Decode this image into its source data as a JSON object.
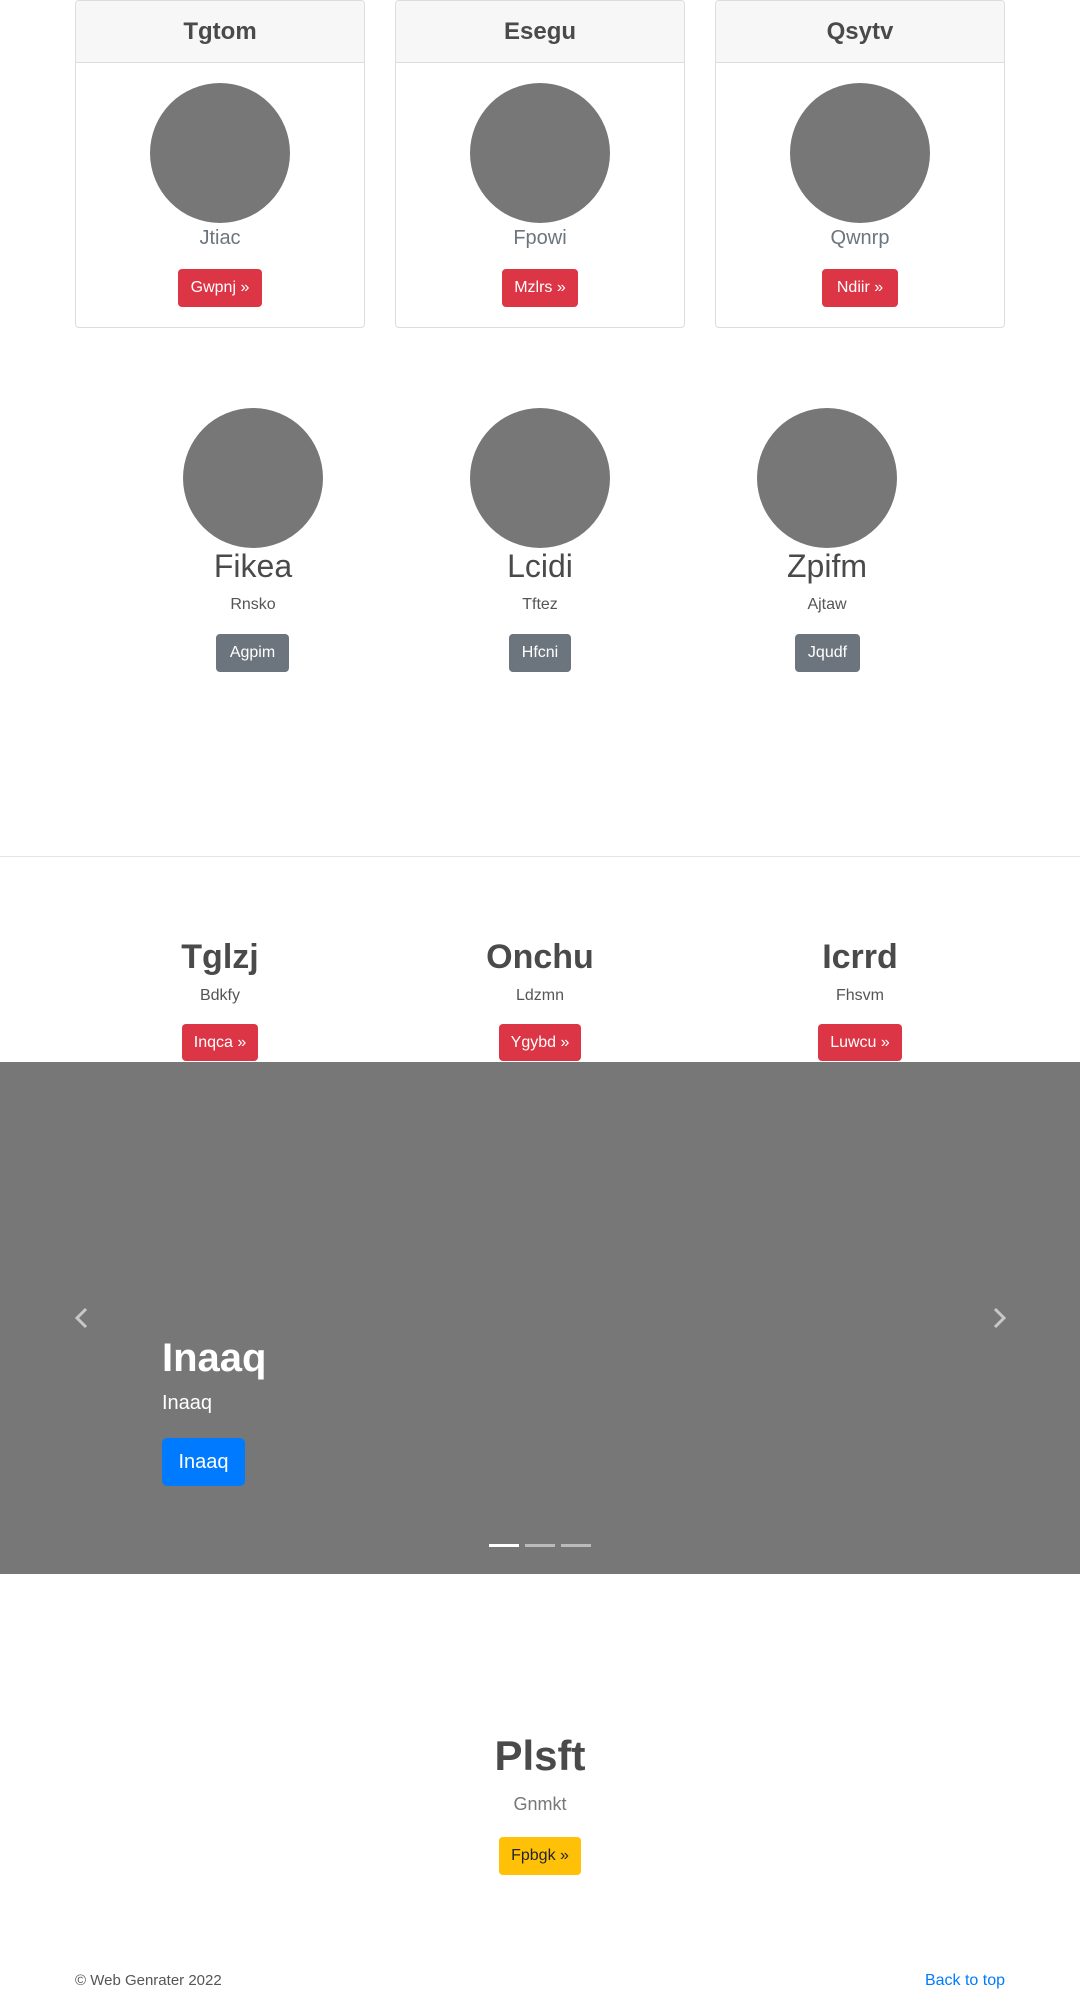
{
  "cards": [
    {
      "header": "Tgtom",
      "text": "Jtiac",
      "button": "Gwpnj »"
    },
    {
      "header": "Esegu",
      "text": "Fpowi",
      "button": "Mzlrs »"
    },
    {
      "header": "Qsytv",
      "text": "Qwnrp",
      "button": "Ndiir »"
    }
  ],
  "circles": [
    {
      "title": "Fikea",
      "subtitle": "Rnsko",
      "button": "Agpim"
    },
    {
      "title": "Lcidi",
      "subtitle": "Tftez",
      "button": "Hfcni"
    },
    {
      "title": "Zpifm",
      "subtitle": "Ajtaw",
      "button": "Jqudf"
    }
  ],
  "features": [
    {
      "title": "Tglzj",
      "subtitle": "Bdkfy",
      "button": "Inqca »"
    },
    {
      "title": "Onchu",
      "subtitle": "Ldzmn",
      "button": "Ygybd »"
    },
    {
      "title": "Icrrd",
      "subtitle": "Fhsvm",
      "button": "Luwcu »"
    }
  ],
  "carousel": {
    "title": "Inaaq",
    "subtitle": "Inaaq",
    "button": "Inaaq",
    "prev_icon": "chevron-left-icon",
    "next_icon": "chevron-right-icon",
    "slide_count": 3,
    "active_slide": 1
  },
  "marketing": {
    "title": "Plsft",
    "subtitle": "Gnmkt",
    "button": "Fpbgk »"
  },
  "footer": {
    "copyright": "© Web Genrater 2022",
    "back_to_top": "Back to top"
  },
  "colors": {
    "danger": "#dc3545",
    "secondary": "#6c757d",
    "primary": "#007bff",
    "warning": "#ffc107",
    "placeholder": "#777777"
  }
}
